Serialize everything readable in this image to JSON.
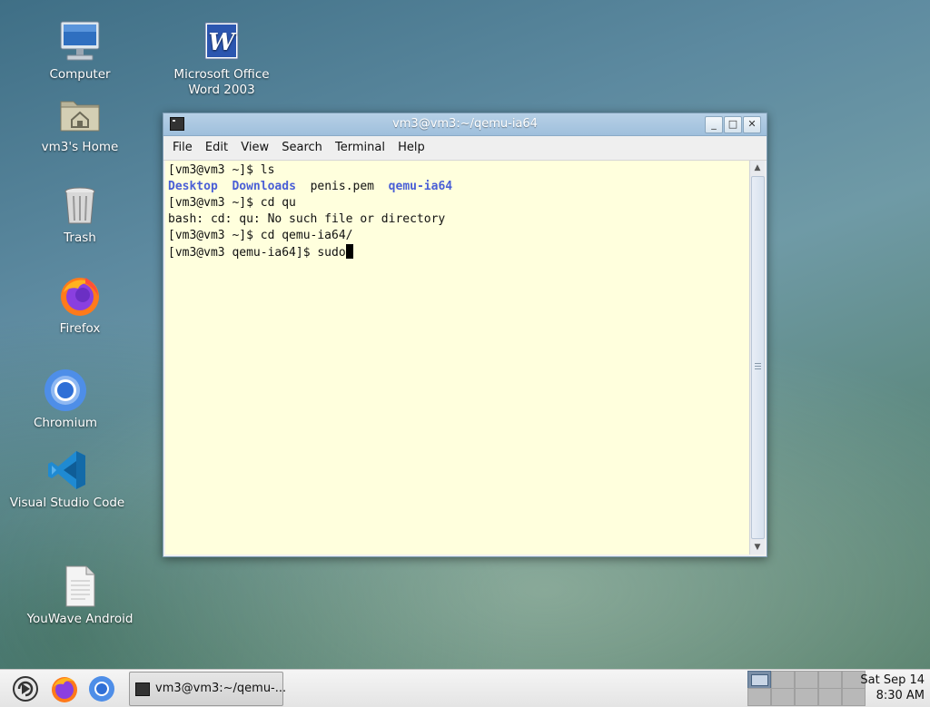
{
  "desktop": {
    "icons": [
      {
        "label": "Computer"
      },
      {
        "label": "Microsoft Office Word 2003"
      },
      {
        "label": "vm3's Home"
      },
      {
        "label": "Trash"
      },
      {
        "label": "Firefox"
      },
      {
        "label": "Chromium"
      },
      {
        "label": "Visual Studio Code"
      },
      {
        "label": "YouWave Android"
      }
    ]
  },
  "window": {
    "title": "vm3@vm3:~/qemu-ia64",
    "buttons": {
      "minimize": "_",
      "maximize": "□",
      "close": "✕"
    },
    "menu": [
      "File",
      "Edit",
      "View",
      "Search",
      "Terminal",
      "Help"
    ]
  },
  "terminal": {
    "line1": "[vm3@vm3 ~]$ ls",
    "ls_items": [
      "Desktop",
      "Downloads",
      "penis.pem",
      "qemu-ia64"
    ],
    "line3": "[vm3@vm3 ~]$ cd qu",
    "line4": "bash: cd: qu: No such file or directory",
    "line5": "[vm3@vm3 ~]$ cd qemu-ia64/",
    "line6": "[vm3@vm3 qemu-ia64]$ sudo"
  },
  "taskbar": {
    "task_label": "vm3@vm3:~/qemu-...",
    "clock_date": "Sat Sep 14",
    "clock_time": "8:30 AM"
  },
  "colors": {
    "terminal_bg": "#ffffdd",
    "directory_blue": "#4a5fd6",
    "titlebar": "#a8c6e0"
  }
}
